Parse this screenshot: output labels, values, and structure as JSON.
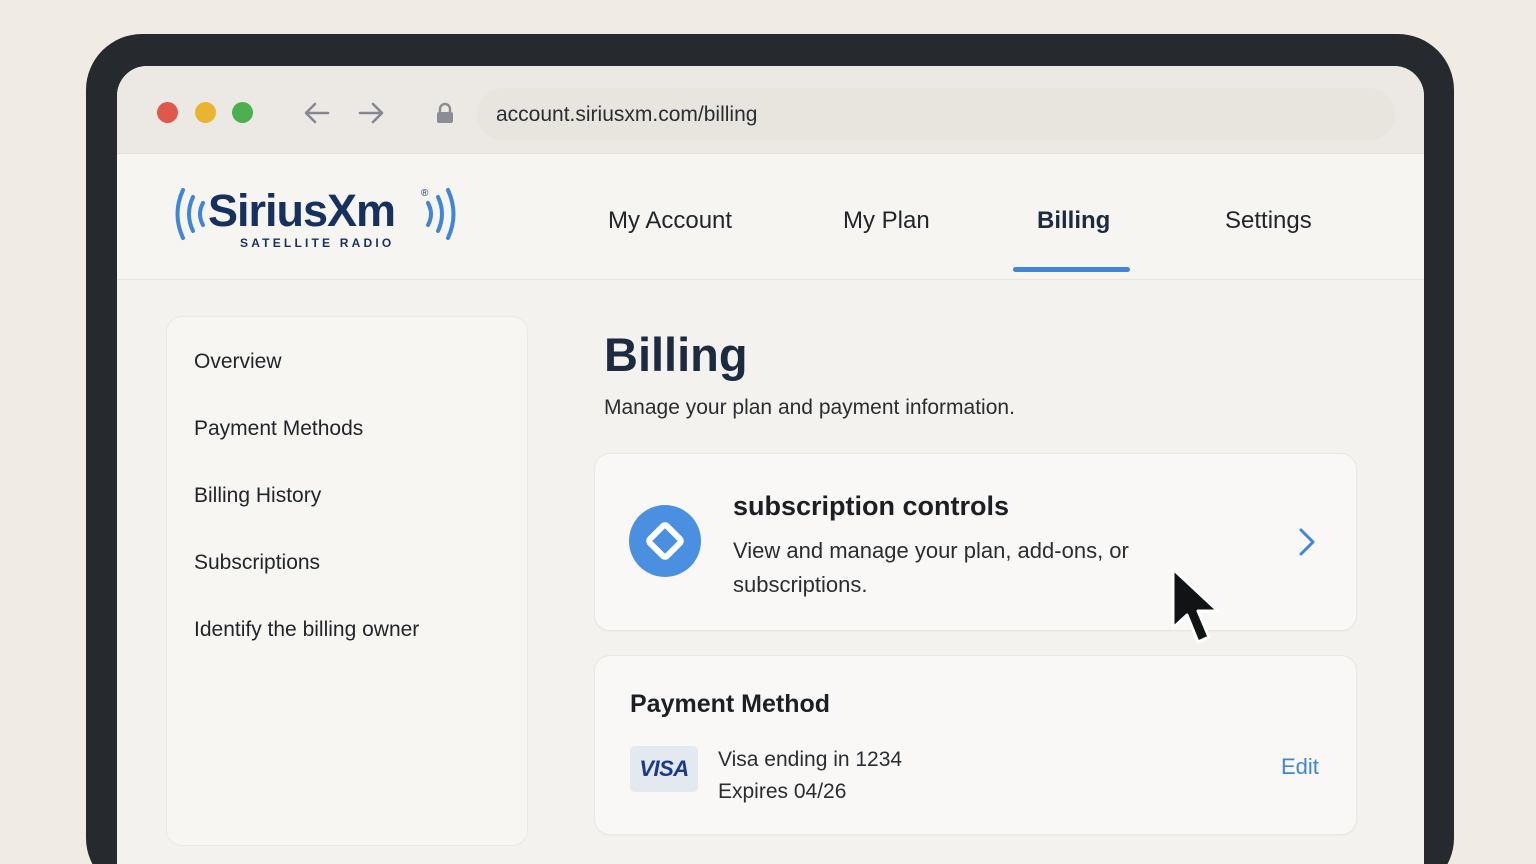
{
  "browser": {
    "url": "account.siriusxm.com/billing"
  },
  "brand": {
    "name": "SiriusXm",
    "tagline": "SATELLITE RADIO",
    "colors": {
      "navy": "#17315f",
      "accent": "#3f86d6"
    }
  },
  "top_nav": {
    "items": [
      {
        "label": "My Account",
        "active": false
      },
      {
        "label": "My Plan",
        "active": false
      },
      {
        "label": "Billing",
        "active": true
      },
      {
        "label": "Settings",
        "active": false
      }
    ]
  },
  "sidebar": {
    "items": [
      {
        "label": "Overview"
      },
      {
        "label": "Payment Methods"
      },
      {
        "label": "Billing History"
      },
      {
        "label": "Subscriptions"
      },
      {
        "label": "Identify the billing owner"
      }
    ]
  },
  "main": {
    "title": "Billing",
    "subtitle": "Manage your plan and payment information.",
    "subscription_card": {
      "title": "subscription controls",
      "description": "View and manage your plan, add-ons, or subscriptions.",
      "icon": "tag-icon",
      "action_icon": "chevron-right-icon"
    },
    "payment_card": {
      "title": "Payment Method",
      "brand": "VISA",
      "card_number": "Visa ending in 1234",
      "expiry": "Expires 04/26",
      "edit_label": "Edit"
    }
  },
  "icons": {
    "back": "arrow-left-icon",
    "forward": "arrow-right-icon",
    "lock": "lock-icon",
    "pointer": "mouse-pointer-icon"
  }
}
